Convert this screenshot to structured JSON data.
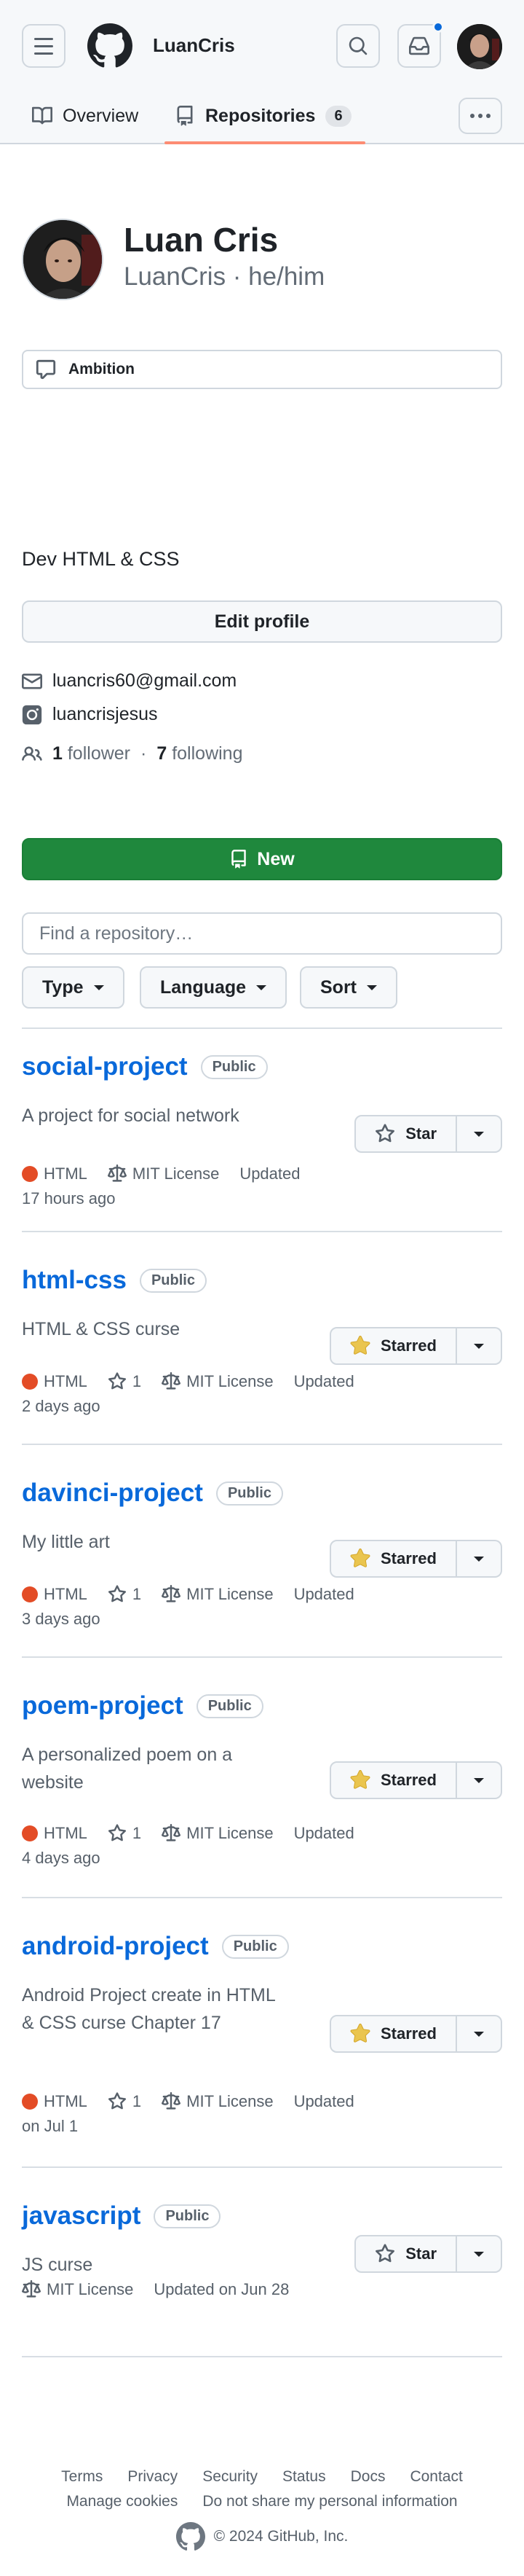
{
  "header": {
    "owner_name": "LuanCris",
    "icons": [
      "menu-icon",
      "github-logo",
      "search-icon",
      "inbox-icon"
    ]
  },
  "tabs": [
    {
      "label": "Overview",
      "icon": "book-icon"
    },
    {
      "label": "Repositories",
      "icon": "repo-icon",
      "count": "6"
    }
  ],
  "profile": {
    "name": "Luan Cris",
    "login_line": "LuanCris · he/him",
    "status": "Ambition",
    "bio": "Dev HTML & CSS",
    "edit_label": "Edit profile",
    "email": "luancris60@gmail.com",
    "instagram": "luancrisjesus",
    "followers_count": "1",
    "followers_label": "follower",
    "following_count": "7",
    "following_label": "following"
  },
  "repo_controls": {
    "new_label": "New",
    "search_placeholder": "Find a repository…",
    "filters": [
      "Type",
      "Language",
      "Sort"
    ]
  },
  "repos": [
    {
      "name": "social-project",
      "visibility": "Public",
      "description": "A project for social network",
      "language": "HTML",
      "stars": "",
      "license": "MIT License",
      "updated": "Updated",
      "updated_when": "17 hours ago",
      "star_label": "Star",
      "starred": false
    },
    {
      "name": "html-css",
      "visibility": "Public",
      "description": "HTML & CSS curse",
      "language": "HTML",
      "stars": "1",
      "license": "MIT License",
      "updated": "Updated",
      "updated_when": "2 days ago",
      "star_label": "Starred",
      "starred": true
    },
    {
      "name": "davinci-project",
      "visibility": "Public",
      "description": "My little art",
      "language": "HTML",
      "stars": "1",
      "license": "MIT License",
      "updated": "Updated",
      "updated_when": "3 days ago",
      "star_label": "Starred",
      "starred": true
    },
    {
      "name": "poem-project",
      "visibility": "Public",
      "description": "A personalized poem on a website",
      "language": "HTML",
      "stars": "1",
      "license": "MIT License",
      "updated": "Updated",
      "updated_when": "4 days ago",
      "star_label": "Starred",
      "starred": true
    },
    {
      "name": "android-project",
      "visibility": "Public",
      "description": "Android Project create in HTML & CSS curse Chapter 17",
      "language": "HTML",
      "stars": "1",
      "license": "MIT License",
      "updated": "Updated",
      "updated_when": "on Jul 1",
      "star_label": "Starred",
      "starred": true
    },
    {
      "name": "javascript",
      "visibility": "Public",
      "description": "JS curse",
      "language": "",
      "stars": "",
      "license": "MIT License",
      "updated": "Updated on Jun 28",
      "updated_when": "",
      "star_label": "Star",
      "starred": false
    }
  ],
  "footer": {
    "row1": [
      "Terms",
      "Privacy",
      "Security",
      "Status",
      "Docs",
      "Contact"
    ],
    "row2": [
      "Manage cookies",
      "Do not share my personal information"
    ],
    "copyright": "© 2024 GitHub, Inc."
  },
  "colors": {
    "accent_link": "#0969da",
    "new_button": "#1f883d",
    "html_language": "#e34c26",
    "star_filled": "#eac54f",
    "tab_underline": "#fd8c73"
  }
}
